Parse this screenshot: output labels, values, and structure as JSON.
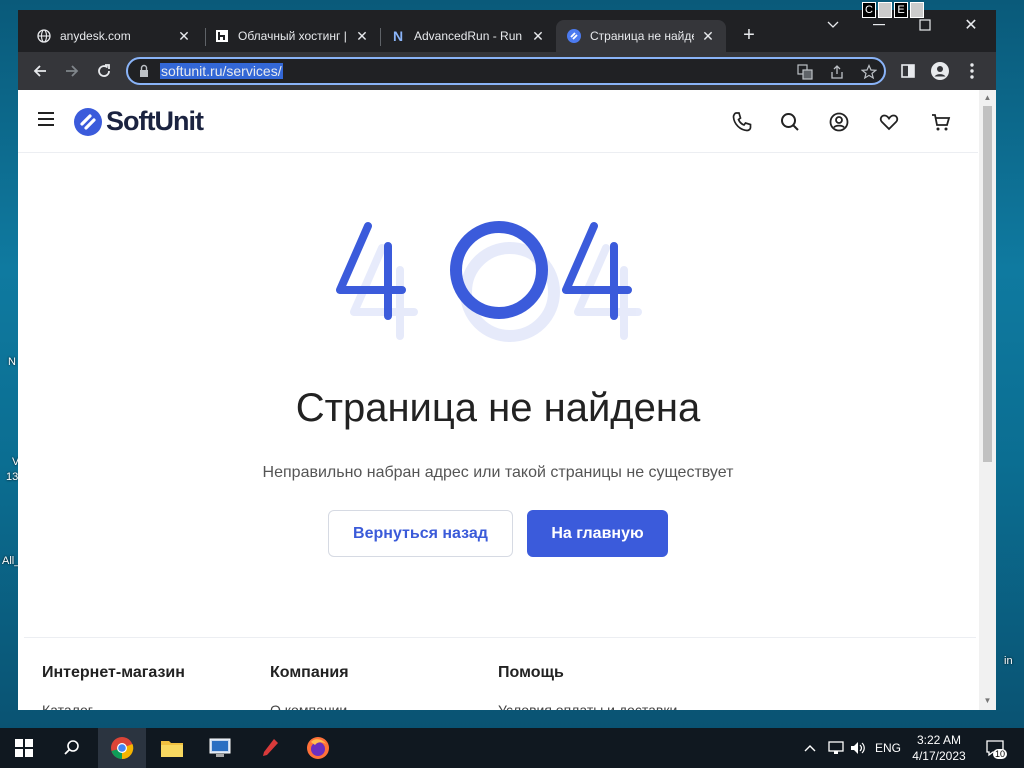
{
  "browser": {
    "tabs": [
      {
        "title": "anydesk.com",
        "icon": "globe-icon"
      },
      {
        "title": "Облачный хостинг |",
        "icon": "hosting-favicon"
      },
      {
        "title": "AdvancedRun - Run",
        "icon": "n-favicon"
      },
      {
        "title": "Страница не найде",
        "icon": "softunit-favicon"
      }
    ],
    "url": "softunit.ru/services/",
    "overlay_letters": [
      "C",
      "E"
    ]
  },
  "site": {
    "logo": "SoftUnit",
    "error_code": "404",
    "title": "Страница не найдена",
    "subtitle": "Неправильно набран адрес или такой страницы не существует",
    "back_button": "Вернуться назад",
    "home_button": "На главную",
    "footer": {
      "col1": "Интернет-магазин",
      "col2": "Компания",
      "col3": "Помощь",
      "col1_item": "Каталог",
      "col2_item": "О компании",
      "col3_item": "Условия оплаты и доставки"
    },
    "colors": {
      "accent": "#3b5bdb",
      "dark": "#1b2340"
    }
  },
  "desktop": {
    "labels": [
      "N",
      "V",
      "13",
      "All_",
      "in"
    ]
  },
  "taskbar": {
    "language": "ENG",
    "time": "3:22 AM",
    "date": "4/17/2023",
    "notifications": "10"
  }
}
